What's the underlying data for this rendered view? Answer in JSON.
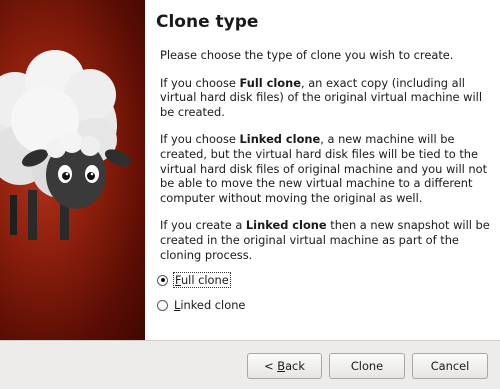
{
  "wizard": {
    "title": "Clone type",
    "intro": "Please choose the type of clone you wish to create.",
    "full_prefix": "If you choose ",
    "full_bold": "Full clone",
    "full_suffix": ", an exact copy (including all virtual hard disk files) of the original virtual machine will be created.",
    "linked_prefix": "If you choose ",
    "linked_bold": "Linked clone",
    "linked_suffix": ", a new machine will be created, but the virtual hard disk files will be tied to the virtual hard disk files of original machine and you will not be able to move the new virtual machine to a different computer without moving the original as well.",
    "snapshot_prefix": "If you create a ",
    "snapshot_bold": "Linked clone",
    "snapshot_suffix": " then a new snapshot will be created in the original virtual machine as part of the cloning process."
  },
  "options": {
    "full_clone": {
      "mnemonic": "F",
      "rest": "ull clone",
      "selected": true
    },
    "linked_clone": {
      "mnemonic": "L",
      "rest": "inked clone",
      "selected": false
    }
  },
  "buttons": {
    "back_prefix": "< ",
    "back_mnemonic": "B",
    "back_rest": "ack",
    "clone": "Clone",
    "cancel": "Cancel"
  },
  "icons": {
    "sidebar_art": "sheep-mascot-icon"
  },
  "colors": {
    "sidebar_bg": "#8a1e0c",
    "footer_bg": "#edeceb"
  }
}
